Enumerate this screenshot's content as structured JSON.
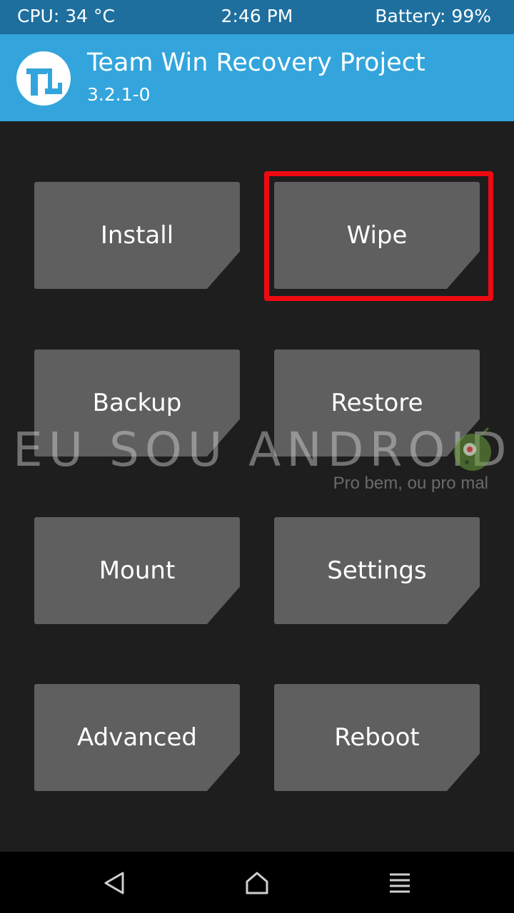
{
  "status": {
    "cpu": "CPU: 34 °C",
    "time": "2:46 PM",
    "battery": "Battery: 99%"
  },
  "header": {
    "title": "Team Win Recovery Project",
    "version": "3.2.1-0",
    "logo_icon": "twrp-logo-icon"
  },
  "tiles": [
    {
      "label": "Install"
    },
    {
      "label": "Wipe"
    },
    {
      "label": "Backup"
    },
    {
      "label": "Restore"
    },
    {
      "label": "Mount"
    },
    {
      "label": "Settings"
    },
    {
      "label": "Advanced"
    },
    {
      "label": "Reboot"
    }
  ],
  "highlighted_tile": "Wipe",
  "watermark": {
    "text": "EU SOU ANDROID",
    "tagline": "Pro bem, ou pro mal"
  },
  "nav": {
    "back_icon": "back-triangle-icon",
    "home_icon": "home-icon",
    "menu_icon": "menu-lines-icon"
  },
  "colors": {
    "status_bar": "#1e6f9e",
    "header": "#33a5dc",
    "background": "#1e1e1e",
    "tile": "#5f5f5f",
    "highlight": "#ee0a12"
  }
}
